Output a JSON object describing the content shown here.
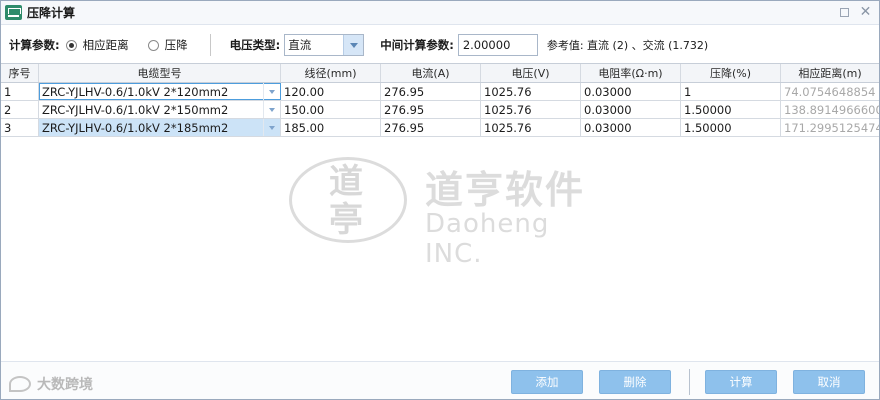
{
  "window": {
    "title": "压降计算"
  },
  "params": {
    "calc_label": "计算参数:",
    "radio_distance": "相应距离",
    "radio_drop": "压降",
    "voltage_type_label": "电压类型:",
    "voltage_type_value": "直流",
    "mid_calc_label": "中间计算参数:",
    "mid_calc_value": "2.00000",
    "reference_text": "参考值: 直流 (2) 、交流 (1.732)"
  },
  "table": {
    "headers": [
      "序号",
      "电缆型号",
      "线径(mm)",
      "电流(A)",
      "电压(V)",
      "电阻率(Ω·m)",
      "压降(%)",
      "相应距离(m)"
    ],
    "rows": [
      [
        "1",
        "ZRC-YJLHV-0.6/1.0kV 2*120mm2",
        "120.00",
        "276.95",
        "1025.76",
        "0.03000",
        "1",
        "74.0754648854"
      ],
      [
        "2",
        "ZRC-YJLHV-0.6/1.0kV 2*150mm2",
        "150.00",
        "276.95",
        "1025.76",
        "0.03000",
        "1.50000",
        "138.8914966600"
      ],
      [
        "3",
        "ZRC-YJLHV-0.6/1.0kV 2*185mm2",
        "185.00",
        "276.95",
        "1025.76",
        "0.03000",
        "1.50000",
        "171.2995125474"
      ]
    ]
  },
  "watermark": {
    "glyph_top": "道",
    "glyph_bottom": "亭",
    "company_cn": "道亨软件",
    "company_en": "Daoheng INC.",
    "bottom_logo_text": "大数跨境"
  },
  "buttons": {
    "add": "添加",
    "delete": "删除",
    "calculate": "计算",
    "cancel": "取消"
  }
}
